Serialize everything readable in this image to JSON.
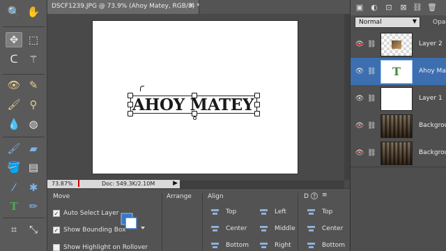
{
  "document": {
    "tab_title": "DSCF1239.JPG @ 73.9% (Ahoy Matey, RGB/8) *",
    "close_glyph": "✕",
    "canvas_text": "AHOY MATEY"
  },
  "status": {
    "zoom": "73.87%",
    "doc_size": "Doc: 549.3K/2.10M",
    "play_glyph": "▶"
  },
  "tools": [
    {
      "icon": "zoom-icon",
      "glyph": "🔍"
    },
    {
      "icon": "hand-icon",
      "glyph": "✋"
    },
    {
      "icon": "move-icon",
      "glyph": "✥"
    },
    {
      "icon": "marquee-icon",
      "glyph": "⬚"
    },
    {
      "icon": "lasso-icon",
      "glyph": "ᑕ"
    },
    {
      "icon": "magic-wand-icon",
      "glyph": "⚚"
    },
    {
      "icon": "red-eye-icon",
      "glyph": "👁"
    },
    {
      "icon": "healing-brush-icon",
      "glyph": "✎"
    },
    {
      "icon": "smart-brush-icon",
      "glyph": "🖌"
    },
    {
      "icon": "clone-stamp-icon",
      "glyph": "⚲"
    },
    {
      "icon": "blur-icon",
      "glyph": "💧"
    },
    {
      "icon": "sponge-icon",
      "glyph": "◍"
    },
    {
      "icon": "brush-icon",
      "glyph": "🖌"
    },
    {
      "icon": "eraser-icon",
      "glyph": "▰"
    },
    {
      "icon": "paint-bucket-icon",
      "glyph": "🪣"
    },
    {
      "icon": "gradient-icon",
      "glyph": "▤"
    },
    {
      "icon": "eyedropper-icon",
      "glyph": "⁄"
    },
    {
      "icon": "shape-icon",
      "glyph": "✱"
    },
    {
      "icon": "type-icon",
      "glyph": "T"
    },
    {
      "icon": "pencil-icon",
      "glyph": "✏"
    },
    {
      "icon": "crop-icon",
      "glyph": "⌗"
    },
    {
      "icon": "straighten-icon",
      "glyph": "⤡"
    }
  ],
  "options": {
    "move_title": "Move",
    "auto_select": "Auto Select Layer",
    "show_bounding": "Show Bounding Box",
    "show_highlight": "Show Highlight on Rollover",
    "auto_select_checked": "✓",
    "show_bounding_checked": "✓",
    "arrange_title": "Arrange",
    "align_title": "Align",
    "align_col1": [
      "Top",
      "Center",
      "Bottom"
    ],
    "align_col2": [
      "Left",
      "Middle",
      "Right"
    ],
    "distribute_title": "D",
    "distribute_col": [
      "Top",
      "Center",
      "Bottom"
    ],
    "help_glyph": "?",
    "menu_glyph": "≡"
  },
  "layers_panel": {
    "blend_mode": "Normal",
    "opacity_label": "Opac",
    "dropdown_glyph": "▼",
    "layers": [
      {
        "name": "Layer 2",
        "visible": false,
        "thumb": "layer2"
      },
      {
        "name": "Ahoy Mate",
        "visible": true,
        "thumb": "text",
        "selected": true
      },
      {
        "name": "Layer 1",
        "visible": true,
        "thumb": "white"
      },
      {
        "name": "Backgrou",
        "visible": false,
        "thumb": "photo"
      },
      {
        "name": "Backgrou",
        "visible": false,
        "thumb": "photo"
      }
    ],
    "text_thumb_glyph": "T",
    "eye_glyph": "👁",
    "link_glyph": "⛓"
  },
  "colors": {
    "selected_layer": "#3d6fb0",
    "panel_bg": "#4e4e4e",
    "canvas_bg": "#ffffff"
  }
}
